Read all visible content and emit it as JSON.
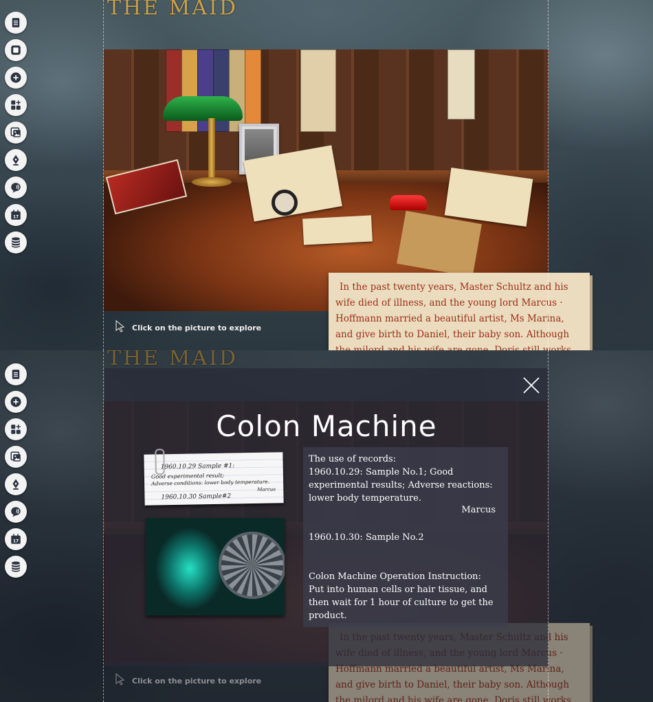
{
  "brand": {
    "logo": "THE MAID"
  },
  "sidebar_top": [
    {
      "name": "document-icon"
    },
    {
      "name": "square-icon"
    },
    {
      "name": "plus-circle-icon"
    },
    {
      "name": "widgets-add-icon"
    },
    {
      "name": "gallery-icon"
    },
    {
      "name": "pen-nib-icon"
    },
    {
      "name": "chat-bubble-icon"
    },
    {
      "name": "calendar-icon",
      "day": "17"
    },
    {
      "name": "database-icon"
    }
  ],
  "sidebar_bottom": [
    {
      "name": "document-icon"
    },
    {
      "name": "plus-circle-icon"
    },
    {
      "name": "widgets-add-icon"
    },
    {
      "name": "gallery-icon"
    },
    {
      "name": "pen-nib-icon"
    },
    {
      "name": "chat-bubble-icon"
    },
    {
      "name": "calendar-icon",
      "day": "17"
    },
    {
      "name": "database-icon"
    }
  ],
  "scene": {
    "hint": "Click on the picture to explore"
  },
  "story": {
    "text": "In the past twenty years, Master Schultz and his wife died of illness, and the young lord Marcus · Hoffmann married a beautiful artist, Ms Marina, and give birth to Daniel, their baby son. Although the milord and his wife are gone, Doris still works hard to keep the home neat and beautiful. Having a"
  },
  "modal": {
    "title": "Colon Machine",
    "note": {
      "line1": "1960.10.29 Sample #1:",
      "line2": "Good experimental result;",
      "line3": "Adverse conditions: lower body temperature.",
      "signature": "Marcus",
      "line5": "1960.10.30 Sample#2"
    },
    "records": {
      "intro": "The use of records:",
      "entry1": "1960.10.29: Sample No.1; Good experimental results; Adverse reactions: lower body temperature.",
      "signature": "Marcus",
      "entry2": "1960.10.30: Sample No.2",
      "instruction": "Colon Machine Operation Instruction: Put into human cells or hair tissue, and then wait for 1 hour of culture to get the product."
    }
  },
  "colors": {
    "logo": "#c9a24a",
    "story_text": "#9b2f17",
    "story_paper": "#ebdcbf",
    "sidebar_button": "#f3f3f3",
    "icon": "#2b3440"
  }
}
